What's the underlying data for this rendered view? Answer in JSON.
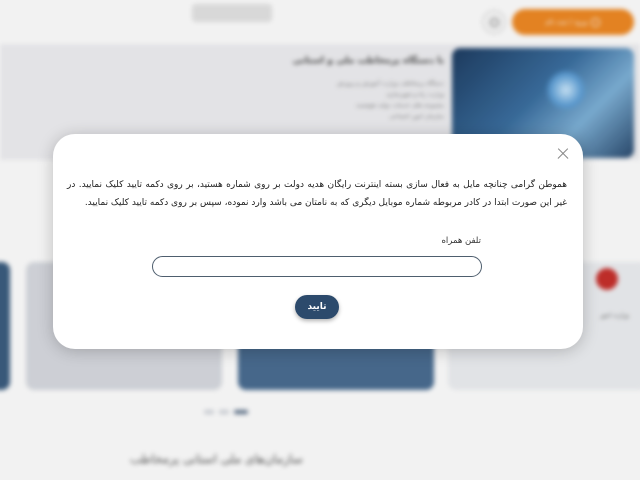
{
  "header": {
    "login_label": "ورود / ثبت نام",
    "search_icon": "search-icon"
  },
  "banner": {
    "title": "با دستگاه پرمخاطب ملی و استانی",
    "lines": [
      "دستگاه پرمخاطب وزارت آموزش و پرورش",
      "وزارت راه و شهرسازی",
      "مجموعه های خدمات دولت هوشمند",
      "سازمان امور اجتماعی"
    ]
  },
  "cards": {
    "card_d_label": "وزارت امور"
  },
  "sections": {
    "title": "سازمان‌های ملی استانی پرمخاطب"
  },
  "modal": {
    "message": "هموطن گرامی چنانچه مایل به فعال سازی بسته اینترنت رایگان هدیه دولت بر روی شماره                   هستید، بر روی دکمه تایید کلیک نمایید. در غیر این صورت ابتدا در کادر مربوطه شماره موبایل دیگری که به نامتان می باشد وارد نموده، سپس بر روی دکمه تایید کلیک نمایید.",
    "phone_label": "تلفن همراه",
    "phone_value": "",
    "confirm_label": "تایید"
  },
  "colors": {
    "login_button": "#f08a24",
    "confirm_button": "#2c4a6c",
    "input_border": "#4e5e6e"
  }
}
